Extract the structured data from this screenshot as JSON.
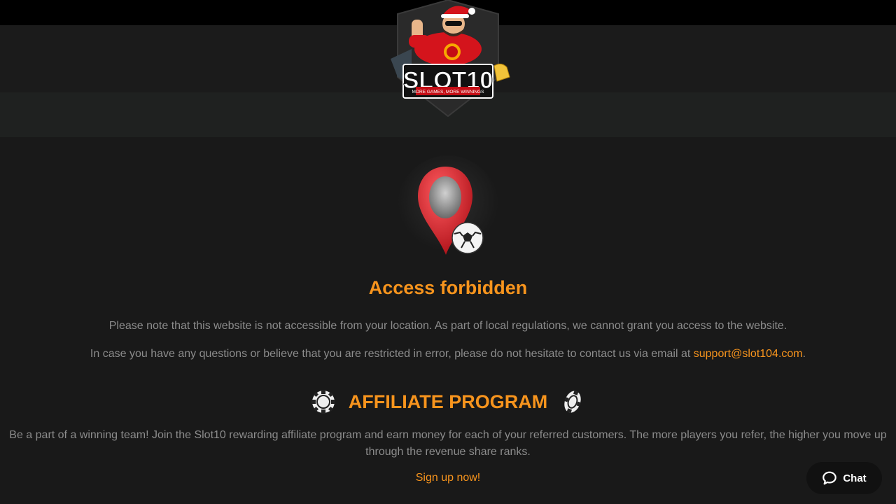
{
  "header": {
    "logo_text": "SLOT10",
    "logo_tagline": "MORE GAMES, MORE WINNINGS"
  },
  "main": {
    "title": "Access forbidden",
    "paragraph_1": "Please note that this website is not accessible from your location. As part of local regulations, we cannot grant you access to the website.",
    "paragraph_2_prefix": "In case you have any questions or believe that you are restricted in error, please do not hesitate to contact us via email at ",
    "email": "support@slot104.com",
    "paragraph_2_suffix": "."
  },
  "affiliate": {
    "title": "AFFILIATE PROGRAM",
    "description": "Be a part of a winning team! Join the Slot10 rewarding affiliate program and earn money for each of your referred customers. The more players you refer, the higher you move up through the revenue share ranks.",
    "signup_label": "Sign up now!"
  },
  "chat": {
    "label": "Chat"
  },
  "colors": {
    "accent": "#f7941d",
    "background": "#191919",
    "topbar": "#000000",
    "navbar": "#1f2120",
    "text": "#8c8c8c"
  },
  "icons": {
    "logo": "slot10-mascot-logo",
    "pin": "location-pin-icon",
    "chip": "poker-chip-icon",
    "chat": "chat-bubble-icon"
  }
}
